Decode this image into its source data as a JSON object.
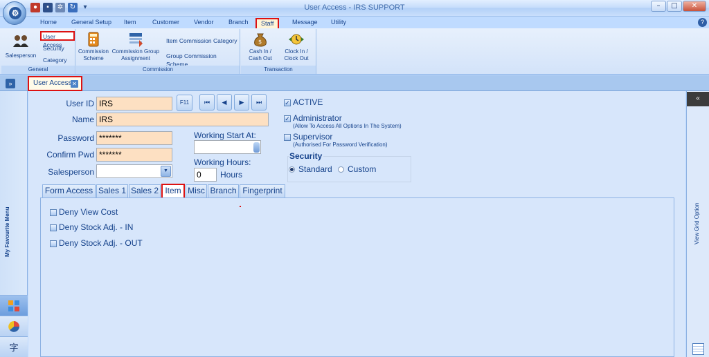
{
  "window": {
    "title": "User Access - IRS SUPPORT",
    "buttons": {
      "minimize": "–",
      "maximize": "□",
      "close": "✕"
    }
  },
  "ribbon": {
    "tabs": [
      "Home",
      "General Setup",
      "Item",
      "Customer",
      "Vendor",
      "Branch",
      "Staff",
      "Message",
      "Utility"
    ],
    "active_tab": "Staff",
    "help": "?",
    "groups": {
      "general": {
        "caption": "General",
        "salesperson": "Salesperson",
        "items": [
          "User Access",
          "Security",
          "Category"
        ]
      },
      "commission": {
        "caption": "Commission",
        "scheme": [
          "Commission",
          "Scheme"
        ],
        "group_assignment": [
          "Commission Group",
          "Assignment"
        ],
        "item_category": "Item Commission Category",
        "group_scheme": "Group Commission Scheme"
      },
      "transaction": {
        "caption": "Transaction",
        "cash": [
          "Cash In /",
          "Cash Out"
        ],
        "clock": [
          "Clock In /",
          "Clock Out"
        ]
      }
    }
  },
  "doc_tab": {
    "label": "User Access"
  },
  "fav_panel": {
    "label": "My Favourite Menu"
  },
  "grid_panel": {
    "label": "View Grid Option",
    "collapse": "«"
  },
  "form": {
    "user_id": {
      "label": "User ID",
      "value": "IRS"
    },
    "name": {
      "label": "Name",
      "value": "IRS"
    },
    "password": {
      "label": "Password",
      "value": "*******"
    },
    "confirm_pwd": {
      "label": "Confirm Pwd",
      "value": "*******"
    },
    "salesperson": {
      "label": "Salesperson",
      "value": ""
    },
    "f11": "F11",
    "nav": [
      "⏮",
      "◀",
      "▶",
      "⏭"
    ],
    "working_start": {
      "label": "Working Start At:",
      "value": ""
    },
    "working_hours": {
      "label": "Working Hours:",
      "value": "0",
      "unit": "Hours"
    },
    "active": {
      "label": "ACTIVE",
      "checked": true
    },
    "administrator": {
      "label": "Administrator",
      "sub": "(Allow To Access All Options In The System)",
      "checked": true
    },
    "supervisor": {
      "label": "Supervisor",
      "sub": "(Authorised For Password Verification)",
      "checked": false
    },
    "security": {
      "title": "Security",
      "options": [
        "Standard",
        "Custom"
      ],
      "selected": "Standard"
    }
  },
  "inner_tabs": {
    "labels": [
      "Form Access",
      "Sales 1",
      "Sales 2",
      "Item",
      "Misc",
      "Branch",
      "Fingerprint"
    ],
    "active": "Item"
  },
  "item_tab": {
    "options": [
      "Deny View Cost",
      "Deny Stock Adj. - IN",
      "Deny Stock Adj. - OUT"
    ]
  },
  "colors": {
    "highlight_border": "#dd1111",
    "required_field": "#fde0c2",
    "accent": "#15428b"
  }
}
